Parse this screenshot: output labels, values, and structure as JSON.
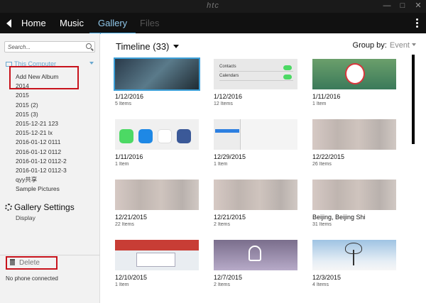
{
  "window": {
    "brand": "htc"
  },
  "nav": {
    "tabs": [
      {
        "label": "Home"
      },
      {
        "label": "Music"
      },
      {
        "label": "Gallery"
      },
      {
        "label": "Files"
      }
    ],
    "active": "Gallery"
  },
  "sidebar": {
    "search_placeholder": "Search...",
    "computer_label": "This Computer",
    "albums": [
      "Add New Album",
      "2014",
      "2015",
      "2015 (2)",
      "2015 (3)",
      "2015-12-21 123",
      "2015-12-21 lx",
      "2016-01-12 0111",
      "2016-01-12 0112",
      "2016-01-12 0112-2",
      "2016-01-12 0112-3",
      "qyy共享",
      "Sample Pictures"
    ],
    "settings_label": "Gallery Settings",
    "display_label": "Display",
    "delete_label": "Delete",
    "phone_status": "No phone connected"
  },
  "main": {
    "timeline_label": "Timeline (33)",
    "groupby_label": "Group by:",
    "groupby_value": "Event",
    "tiles": [
      {
        "date": "1/12/2016",
        "items": "5 Items",
        "thumb": "dark",
        "selected": true
      },
      {
        "date": "1/12/2016",
        "items": "12 Items",
        "thumb": "ios"
      },
      {
        "date": "1/11/2016",
        "items": "1 Item",
        "thumb": "cartoon"
      },
      {
        "date": "1/11/2016",
        "items": "1 Item",
        "thumb": "apps"
      },
      {
        "date": "12/29/2015",
        "items": "1 Item",
        "thumb": "settings"
      },
      {
        "date": "12/22/2015",
        "items": "26 Items",
        "thumb": "blur"
      },
      {
        "date": "12/21/2015",
        "items": "22 Items",
        "thumb": "blur"
      },
      {
        "date": "12/21/2015",
        "items": "2 Items",
        "thumb": "blur"
      },
      {
        "date": "Beijing, Beijing Shi",
        "items": "31 Items",
        "thumb": "blur"
      },
      {
        "date": "12/10/2015",
        "items": "1 Item",
        "thumb": "ui"
      },
      {
        "date": "12/7/2015",
        "items": "2 Items",
        "thumb": "notif"
      },
      {
        "date": "12/3/2015",
        "items": "4 Items",
        "thumb": "tree"
      }
    ]
  },
  "thumb_text": {
    "ios_rows": [
      "Contacts",
      "Calendars"
    ]
  },
  "colors": {
    "accent": "#3b9fd8",
    "highlight_box": "#c8131c"
  }
}
